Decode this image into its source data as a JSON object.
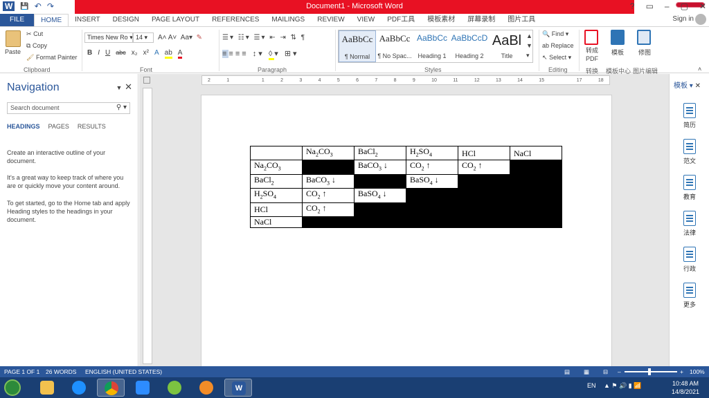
{
  "window": {
    "title": "Document1 - Microsoft Word",
    "help": "?",
    "minimize": "–",
    "restore": "▢",
    "close": "✕"
  },
  "qat": {
    "save": "💾",
    "undo": "↶",
    "redo": "↷"
  },
  "tabs": [
    "FILE",
    "HOME",
    "INSERT",
    "DESIGN",
    "PAGE LAYOUT",
    "REFERENCES",
    "MAILINGS",
    "REVIEW",
    "VIEW",
    "PDF工具",
    "模板素材",
    "屏幕录制",
    "图片工具"
  ],
  "active_tab": "HOME",
  "signin": "Sign in",
  "clipboard": {
    "paste": "Paste",
    "cut": "Cut",
    "copy": "Copy",
    "format_painter": "Format Painter",
    "label": "Clipboard"
  },
  "font": {
    "name": "Times New Ro",
    "size": "14",
    "label": "Font"
  },
  "paragraph": {
    "label": "Paragraph"
  },
  "styles": {
    "label": "Styles",
    "items": [
      {
        "preview": "AaBbCc",
        "name": "¶ Normal"
      },
      {
        "preview": "AaBbCc",
        "name": "¶ No Spac..."
      },
      {
        "preview": "AaBbCc",
        "name": "Heading 1"
      },
      {
        "preview": "AaBbCcD",
        "name": "Heading 2"
      },
      {
        "preview": "AaBl",
        "name": "Title"
      }
    ]
  },
  "editing": {
    "find": "Find",
    "replace": "Replace",
    "select": "Select",
    "label": "Editing"
  },
  "extra_groups": {
    "to_pdf": "转成PDF",
    "to_pdf_label": "转换",
    "template": "模板",
    "template_label": "模板中心",
    "edit_pic": "修图",
    "edit_pic_label": "图片编辑"
  },
  "nav": {
    "title": "Navigation",
    "search_placeholder": "Search document",
    "tabs": [
      "HEADINGS",
      "PAGES",
      "RESULTS"
    ],
    "para1": "Create an interactive outline of your document.",
    "para2": "It's a great way to keep track of where you are or quickly move your content around.",
    "para3": "To get started, go to the Home tab and apply Heading styles to the headings in your document."
  },
  "ruler": {
    "h_ticks": [
      "2",
      "1",
      "",
      "1",
      "2",
      "3",
      "4",
      "5",
      "6",
      "7",
      "8",
      "9",
      "10",
      "11",
      "12",
      "13",
      "14",
      "15",
      "",
      "17",
      "18"
    ]
  },
  "doc_table": {
    "rows": [
      [
        {
          "t": ""
        },
        {
          "t": "Na",
          "s": "2",
          "r": "CO",
          "s2": "3"
        },
        {
          "t": "BaCl",
          "s": "2"
        },
        {
          "t": "H",
          "s": "2",
          "r": "SO",
          "s2": "4"
        },
        {
          "t": "HCl"
        },
        {
          "t": "NaCl"
        }
      ],
      [
        {
          "t": "Na",
          "s": "2",
          "r": "CO",
          "s2": "3"
        },
        {
          "black": true
        },
        {
          "t": "BaCO",
          "s": "3",
          "r": " ↓"
        },
        {
          "t": "CO",
          "s": "2",
          "r": " ↑"
        },
        {
          "t": "CO",
          "s": "2",
          "r": " ↑"
        },
        {
          "black": true
        }
      ],
      [
        {
          "t": "BaCl",
          "s": "2"
        },
        {
          "t": "BaCO",
          "s": "3",
          "r": " ↓"
        },
        {
          "black": true
        },
        {
          "t": "BaSO",
          "s": "4",
          "r": " ↓"
        },
        {
          "black": true
        },
        {
          "black": true
        }
      ],
      [
        {
          "t": "H",
          "s": "2",
          "r": "SO",
          "s2": "4"
        },
        {
          "t": "CO",
          "s": "2",
          "r": " ↑"
        },
        {
          "t": "BaSO",
          "s": "4",
          "r": " ↓"
        },
        {
          "black": true
        },
        {
          "black": true
        },
        {
          "black": true
        }
      ],
      [
        {
          "t": "HCl"
        },
        {
          "t": "CO",
          "s": "2",
          "r": " ↑"
        },
        {
          "black": true
        },
        {
          "black": true
        },
        {
          "black": true
        },
        {
          "black": true
        }
      ],
      [
        {
          "t": "NaCl"
        },
        {
          "black": true
        },
        {
          "black": true
        },
        {
          "black": true
        },
        {
          "black": true
        },
        {
          "black": true
        }
      ]
    ]
  },
  "right_pane": {
    "title": "模板",
    "items": [
      "简历",
      "范文",
      "教育",
      "法律",
      "行政",
      "更多"
    ]
  },
  "status": {
    "page": "PAGE 1 OF 1",
    "words": "26 WORDS",
    "lang": "ENGLISH (UNITED STATES)",
    "zoom": "100%"
  },
  "taskbar": {
    "lang": "EN",
    "time": "10:48 AM",
    "date": "14/8/2021"
  },
  "colors": {
    "word_blue": "#2b579a",
    "title_red": "#e81123"
  }
}
